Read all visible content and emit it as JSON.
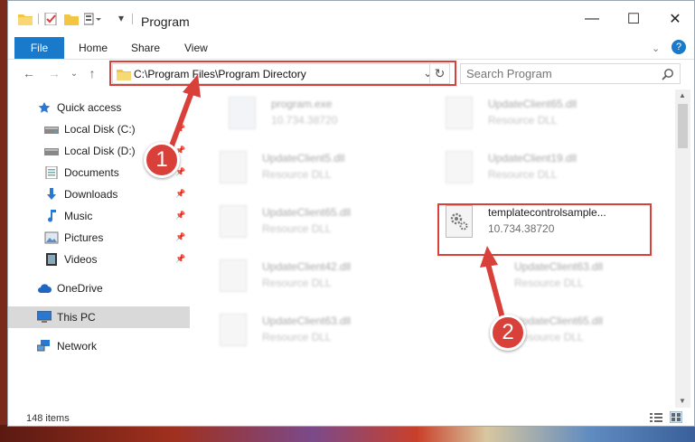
{
  "window": {
    "title": "Program",
    "controls": {
      "minimize": "—",
      "maximize": "☐",
      "close": "✕"
    }
  },
  "ribbon": {
    "tabs": [
      "File",
      "Home",
      "Share",
      "View"
    ],
    "help_glyph": "?"
  },
  "address": {
    "path": "C:\\Program Files\\Program Directory",
    "dropdown_glyph": "⌄",
    "refresh_glyph": "↻"
  },
  "search": {
    "placeholder": "Search Program"
  },
  "nav": {
    "items": [
      {
        "label": "Quick access",
        "icon": "star-icon",
        "pinned": false
      },
      {
        "label": "Local Disk (C:)",
        "icon": "drive-icon",
        "pinned": true
      },
      {
        "label": "Local Disk (D:)",
        "icon": "drive-icon",
        "pinned": true
      },
      {
        "label": "Documents",
        "icon": "documents-icon",
        "pinned": true
      },
      {
        "label": "Downloads",
        "icon": "download-icon",
        "pinned": true
      },
      {
        "label": "Music",
        "icon": "music-icon",
        "pinned": true
      },
      {
        "label": "Pictures",
        "icon": "pictures-icon",
        "pinned": true
      },
      {
        "label": "Videos",
        "icon": "videos-icon",
        "pinned": true
      },
      {
        "label": "OneDrive",
        "icon": "cloud-icon",
        "pinned": false
      },
      {
        "label": "This PC",
        "icon": "computer-icon",
        "pinned": false,
        "selected": true
      },
      {
        "label": "Network",
        "icon": "network-icon",
        "pinned": false
      }
    ]
  },
  "files": [
    {
      "name": "program.exe",
      "sub": "10.734.38720"
    },
    {
      "name": "UpdateClient65.dll",
      "sub": "Resource DLL"
    },
    {
      "name": "UpdateClient5.dll",
      "sub": "Resource DLL"
    },
    {
      "name": "UpdateClient19.dll",
      "sub": "Resource DLL"
    },
    {
      "name": "UpdateClient65.dll",
      "sub": "Resource DLL"
    },
    {
      "name": "templatecontrolsample...",
      "sub": "10.734.38720",
      "highlighted": true
    },
    {
      "name": "UpdateClient42.dll",
      "sub": "Resource DLL"
    },
    {
      "name": "UpdateClient63.dll",
      "sub": "Resource DLL"
    },
    {
      "name": "UpdateClient63.dll",
      "sub": "Resource DLL"
    },
    {
      "name": "UpdateClient65.dll",
      "sub": "Resource DLL"
    }
  ],
  "callouts": {
    "one": "1",
    "two": "2"
  },
  "status": {
    "count": "148 items"
  },
  "colors": {
    "accent": "#1979ca",
    "callout": "#d9403a",
    "folder": "#f4c542"
  }
}
